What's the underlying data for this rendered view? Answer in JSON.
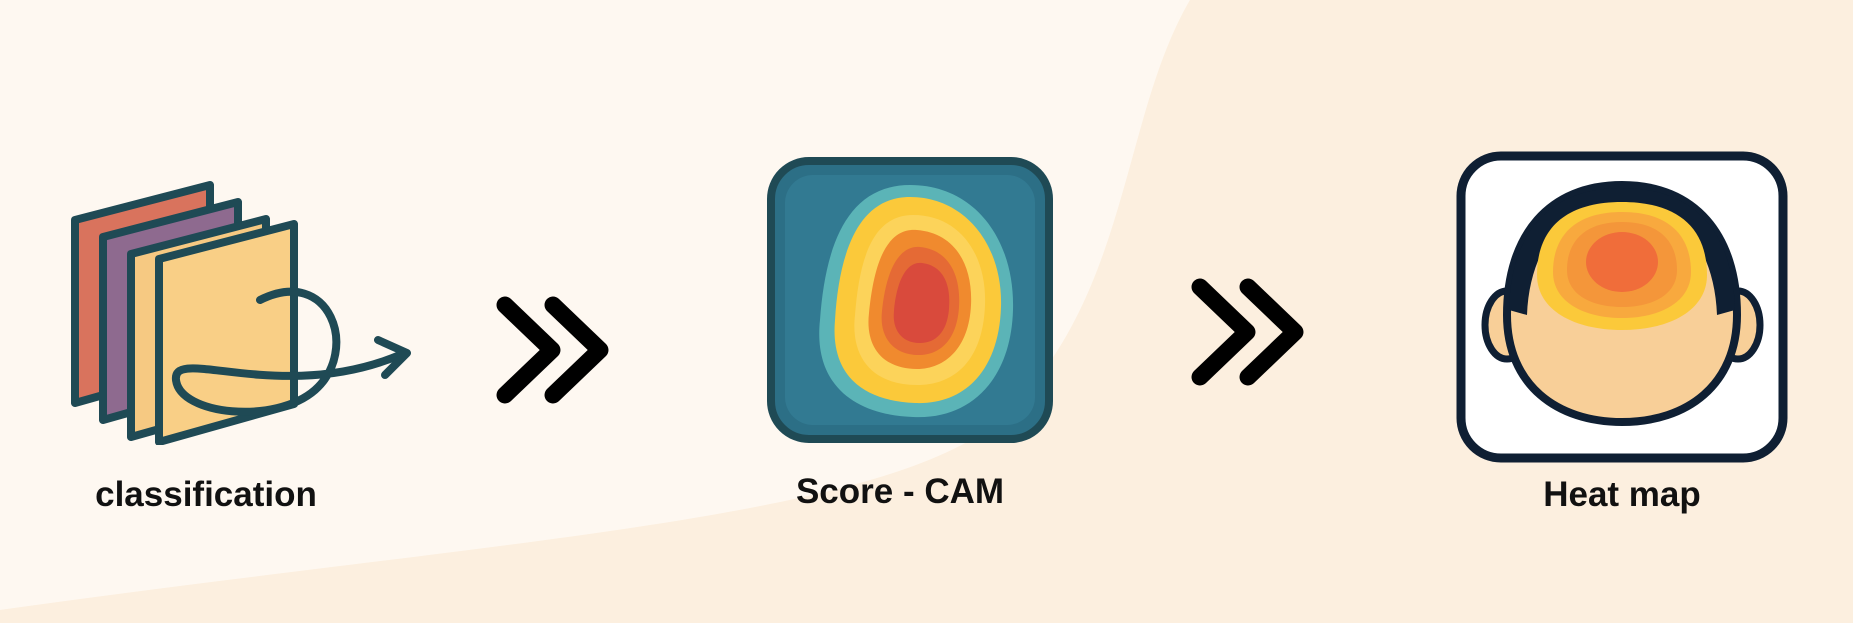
{
  "pipeline": {
    "steps": [
      {
        "id": "classification",
        "label": "classification",
        "icon": "layered-feature-maps-icon"
      },
      {
        "id": "score-cam",
        "label": "Score - CAM",
        "icon": "activation-contour-map-icon"
      },
      {
        "id": "heat-map",
        "label": "Heat map",
        "icon": "head-heatmap-icon"
      }
    ],
    "connectors": [
      "double-chevron-right-icon",
      "double-chevron-right-icon"
    ]
  },
  "colors": {
    "background": "#fdf3e6",
    "outline": "#1f4a55",
    "arrow": "#000000",
    "heat_red": "#d94a3c",
    "heat_orange": "#f08a2e",
    "heat_yellow": "#fbc93a",
    "teal": "#2c6f86",
    "skin": "#f8cf98",
    "hair": "#0f1f33"
  }
}
